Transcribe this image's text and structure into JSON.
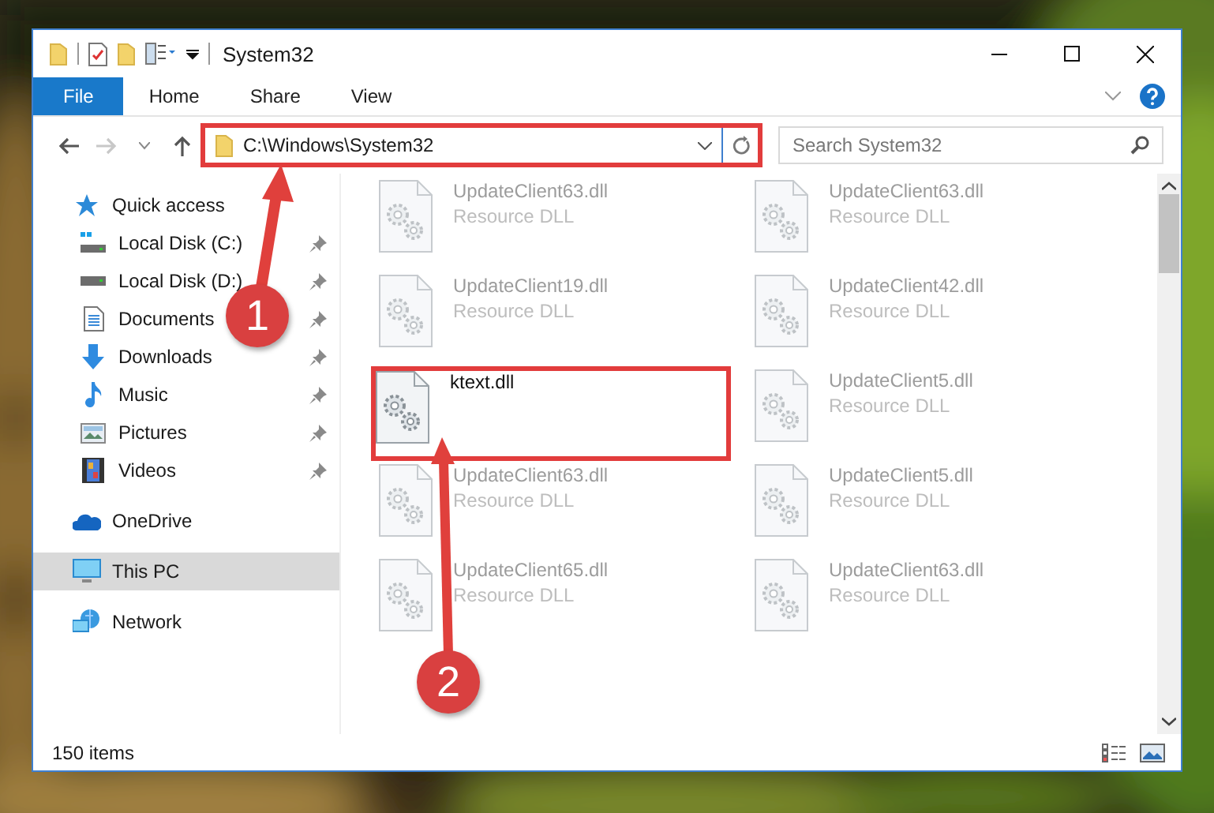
{
  "window": {
    "title": "System32"
  },
  "ribbon": {
    "tabs": [
      {
        "label": "File",
        "selected": true
      },
      {
        "label": "Home",
        "selected": false
      },
      {
        "label": "Share",
        "selected": false
      },
      {
        "label": "View",
        "selected": false
      }
    ]
  },
  "address": {
    "path": "C:\\Windows\\System32",
    "outlined": true
  },
  "search": {
    "placeholder": "Search System32"
  },
  "navigation": [
    {
      "label": "Quick access",
      "selected": false,
      "children": [
        {
          "label": "Local Disk (C:)",
          "pinned": true,
          "selected": false
        },
        {
          "label": "Local Disk (D:)",
          "pinned": true,
          "selected": false
        },
        {
          "label": "Documents",
          "pinned": true,
          "selected": false
        },
        {
          "label": "Downloads",
          "pinned": true,
          "selected": false
        },
        {
          "label": "Music",
          "pinned": true,
          "selected": false
        },
        {
          "label": "Pictures",
          "pinned": true,
          "selected": false
        },
        {
          "label": "Videos",
          "pinned": true,
          "selected": false
        }
      ]
    },
    {
      "label": "OneDrive",
      "selected": false
    },
    {
      "label": "This PC",
      "selected": true
    },
    {
      "label": "Network",
      "selected": false
    }
  ],
  "files": [
    {
      "name": "UpdateClient63.dll",
      "type": "Resource DLL",
      "blurred": true,
      "outlined": false
    },
    {
      "name": "UpdateClient63.dll",
      "type": "Resource DLL",
      "blurred": true,
      "outlined": false
    },
    {
      "name": "UpdateClient19.dll",
      "type": "Resource DLL",
      "blurred": true,
      "outlined": false
    },
    {
      "name": "UpdateClient42.dll",
      "type": "Resource DLL",
      "blurred": true,
      "outlined": false
    },
    {
      "name": "ktext.dll",
      "blurred": false,
      "outlined": true
    },
    {
      "name": "UpdateClient5.dll",
      "type": "Resource DLL",
      "blurred": true,
      "outlined": false
    },
    {
      "name": "UpdateClient63.dll",
      "type": "Resource DLL",
      "blurred": true,
      "outlined": false
    },
    {
      "name": "UpdateClient5.dll",
      "type": "Resource DLL",
      "blurred": true,
      "outlined": false
    },
    {
      "name": "UpdateClient65.dll",
      "type": "Resource DLL",
      "blurred": true,
      "outlined": false
    },
    {
      "name": "UpdateClient63.dll",
      "type": "Resource DLL",
      "blurred": true,
      "outlined": false
    }
  ],
  "status_bar": {
    "item_count": "150 items"
  },
  "annotations": [
    {
      "label": "1"
    },
    {
      "label": "2"
    }
  ]
}
